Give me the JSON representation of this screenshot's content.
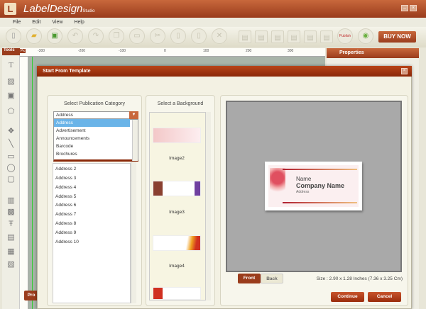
{
  "app": {
    "logo": "L",
    "title": "LabelDesign",
    "subtitle": "Studio",
    "minimize": "–",
    "close": "×"
  },
  "menu": [
    "File",
    "Edit",
    "View",
    "Help"
  ],
  "toolbar": {
    "buy_now": "BUY NOW",
    "publish": "Publish",
    "icons": [
      "new-icon",
      "open-icon",
      "save-icon",
      "undo-icon",
      "redo-icon",
      "copy-icon",
      "paste-icon",
      "cut-icon",
      "duplicate-icon",
      "clipboard-icon",
      "delete-icon",
      "align-left-icon",
      "align-center-icon",
      "align-right-icon",
      "align-top-icon",
      "align-middle-icon",
      "align-bottom-icon",
      "publish-icon",
      "share-icon"
    ]
  },
  "tools": {
    "header": "Tools"
  },
  "ruler": {
    "unit": "Px",
    "ticks": [
      "-300",
      "-200",
      "-100",
      "0",
      "100",
      "200",
      "300"
    ]
  },
  "properties": {
    "header": "Properties"
  },
  "dialog": {
    "title": "Start From Template",
    "category": {
      "header": "Select Publication Category",
      "selected": "Address",
      "dropdown_options": [
        "Address",
        "Advertisement",
        "Announcements",
        "Barcode",
        "Brochures"
      ],
      "items": [
        "Address 2",
        "Address 3",
        "Address 4",
        "Address 5",
        "Address 6",
        "Address 7",
        "Address 8",
        "Address 9",
        "Address 10"
      ]
    },
    "background": {
      "header": "Select a Background",
      "items": [
        "Image2",
        "Image3",
        "Image4"
      ]
    },
    "preview": {
      "name": "Name",
      "company": "Company Name",
      "address": "Address",
      "size": "Size : 2.90 x 1.28 Inches (7.36 x 3.25 Cm)"
    },
    "front": "Front",
    "back": "Back",
    "continue": "Continue",
    "cancel": "Cancel"
  },
  "bottom_button": "Pro"
}
